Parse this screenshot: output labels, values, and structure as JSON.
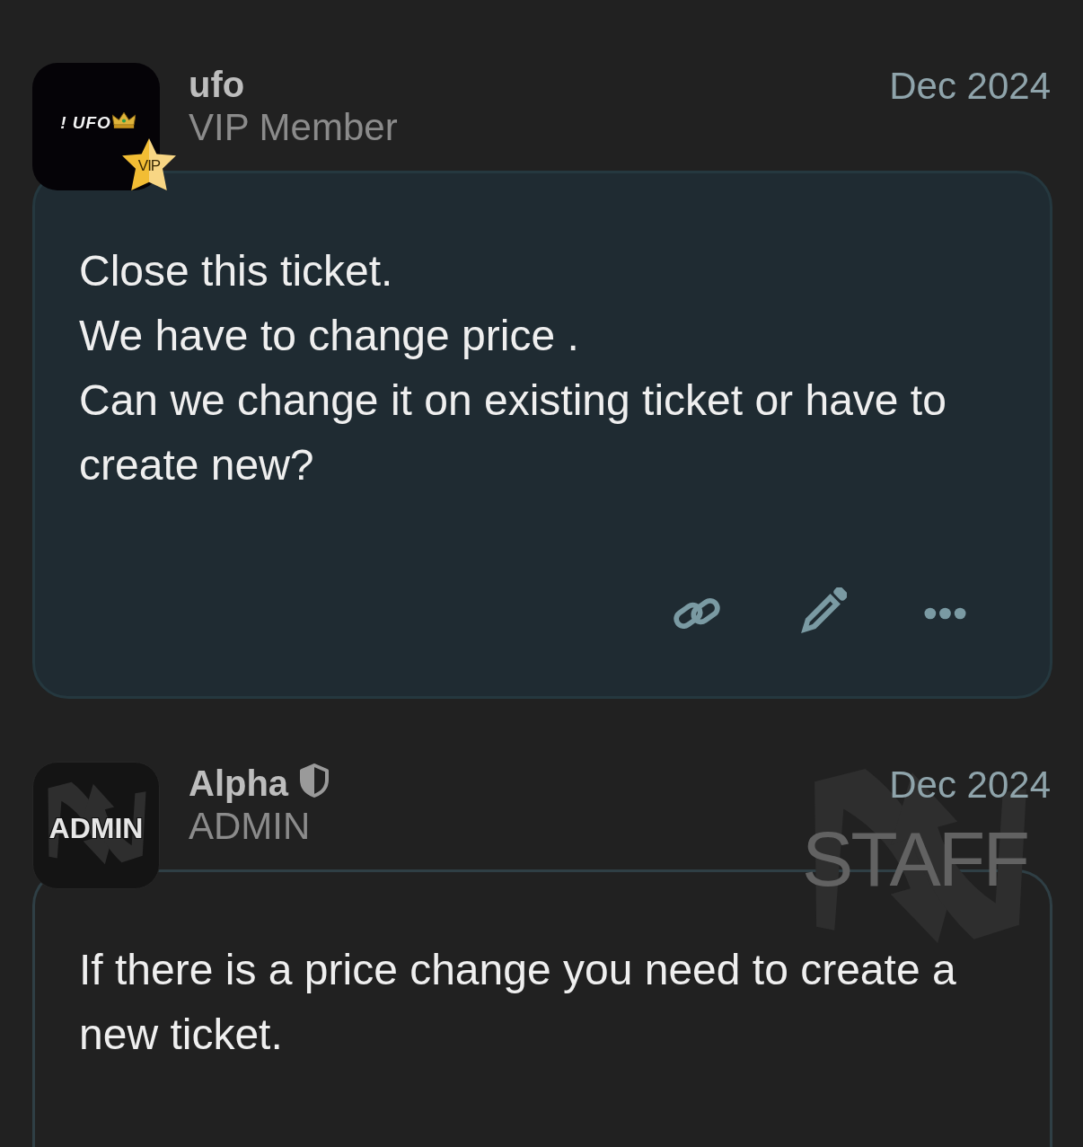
{
  "posts": [
    {
      "kind": "member",
      "author": {
        "name": "ufo",
        "role": "VIP Member",
        "shield": false,
        "avatar": {
          "kind": "vip",
          "text": "! UFO",
          "badge": "VIP"
        }
      },
      "date": "Dec 2024",
      "body": [
        "Close this ticket.",
        "We have to change price .",
        "Can we change it on existing ticket or have to create new?"
      ],
      "actions": [
        {
          "kind": "link"
        },
        {
          "kind": "edit"
        },
        {
          "kind": "more"
        }
      ]
    },
    {
      "kind": "staff",
      "author": {
        "name": "Alpha",
        "role": "ADMIN",
        "shield": true,
        "avatar": {
          "kind": "admin",
          "text": "ADMIN"
        }
      },
      "staff_badge": "STAFF",
      "date": "Dec 2024",
      "body": [
        "If there is a price change you need to create a new ticket."
      ]
    }
  ]
}
